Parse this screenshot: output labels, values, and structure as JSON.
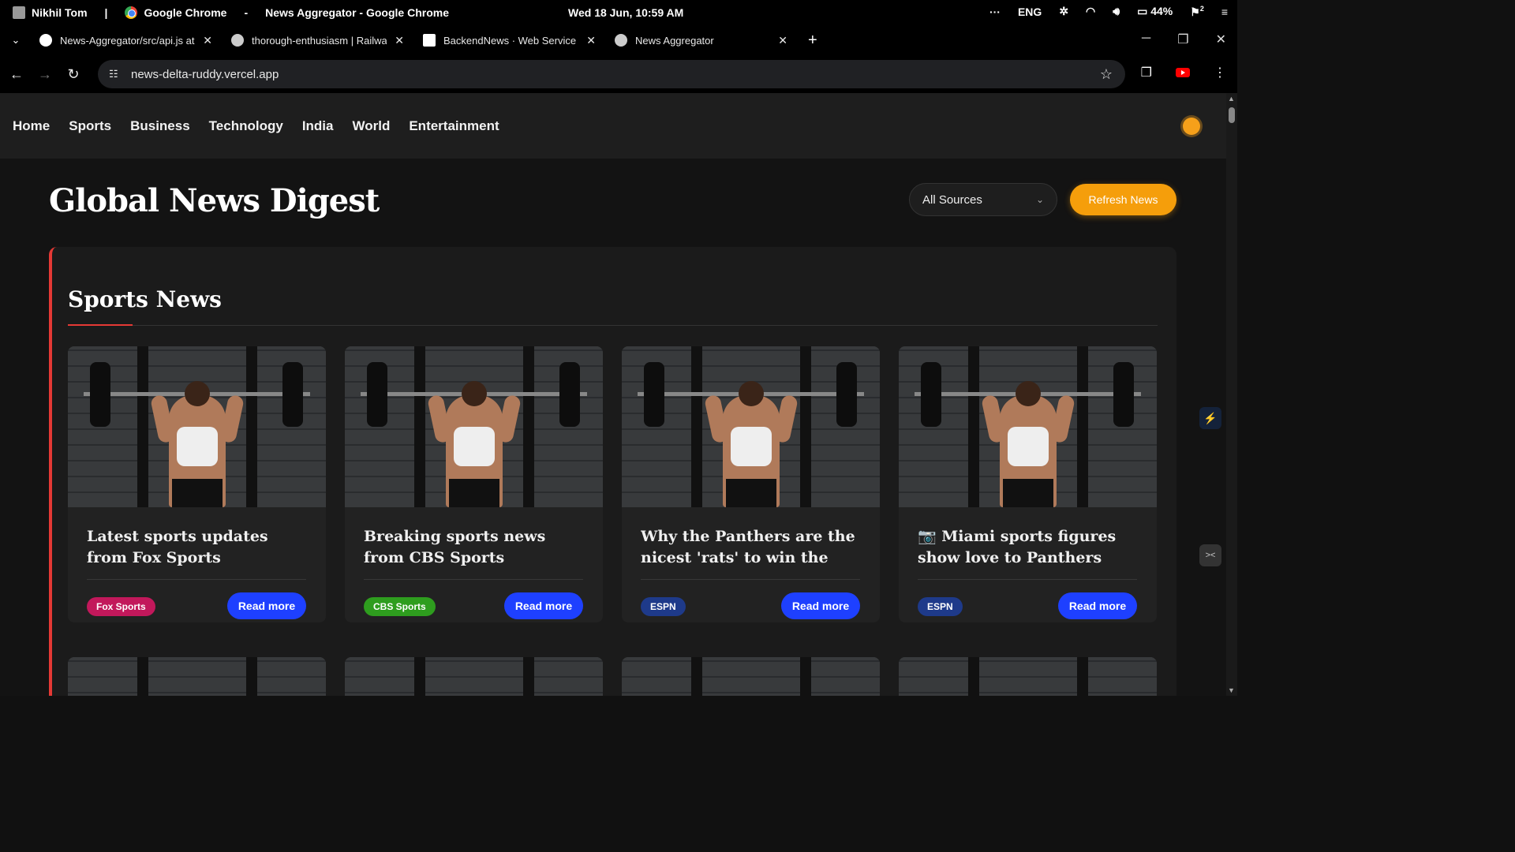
{
  "os": {
    "user": "Nikhil Tom",
    "separator": "|",
    "app": "Google Chrome",
    "dash": "-",
    "window_title": "News Aggregator - Google Chrome",
    "clock": "Wed 18 Jun, 10:59 AM",
    "more": "···",
    "lang": "ENG",
    "battery": "44%",
    "notif_count": "2"
  },
  "tabs": [
    {
      "title": "News-Aggregator/src/api.js at m",
      "close": "✕"
    },
    {
      "title": "thorough-enthusiasm | Railway",
      "close": "✕"
    },
    {
      "title": "BackendNews · Web Service · R",
      "close": "✕"
    },
    {
      "title": "News Aggregator",
      "close": "✕"
    }
  ],
  "browser": {
    "url": "news-delta-ruddy.vercel.app",
    "new_tab": "+"
  },
  "site": {
    "nav": [
      "Home",
      "Sports",
      "Business",
      "Technology",
      "India",
      "World",
      "Entertainment"
    ],
    "title": "Global News Digest",
    "source_select": "All Sources",
    "refresh_label": "Refresh News"
  },
  "section": {
    "title": "Sports News",
    "articles": [
      {
        "title": "Latest sports updates from Fox Sports",
        "source": "Fox Sports",
        "source_color": "#c2185b",
        "cta": "Read more"
      },
      {
        "title": "Breaking sports news from CBS Sports",
        "source": "CBS Sports",
        "source_color": "#2e9d1e",
        "cta": "Read more"
      },
      {
        "title": "Why the Panthers are the nicest 'rats' to win the Stanle...",
        "source": "ESPN",
        "source_color": "#1e3a8a",
        "cta": "Read more"
      },
      {
        "title": "📷 Miami sports figures show love to Panthers after Stanle...",
        "source": "ESPN",
        "source_color": "#1e3a8a",
        "cta": "Read more"
      }
    ]
  },
  "colors": {
    "accent_orange": "#f59e0b",
    "section_accent": "#e53935",
    "button_blue": "#1e40ff"
  }
}
